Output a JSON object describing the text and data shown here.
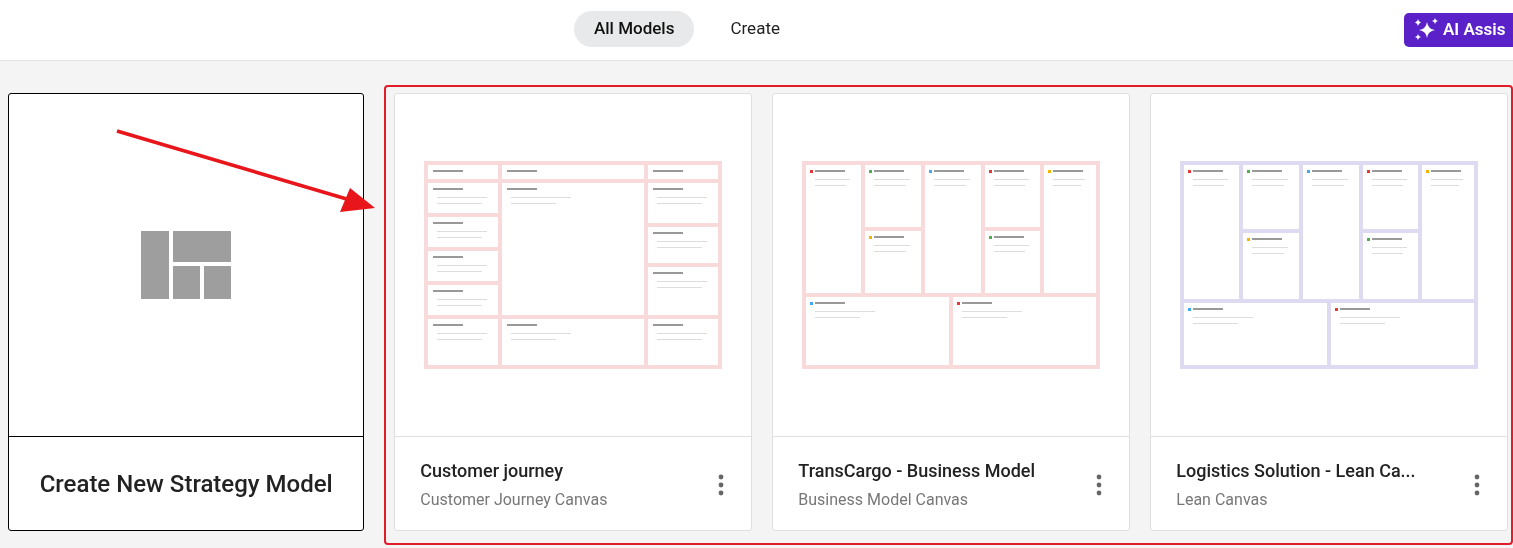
{
  "tabs": [
    {
      "label": "All Models",
      "selected": true
    },
    {
      "label": "Create",
      "selected": false
    }
  ],
  "ai_button": {
    "label": "AI Assis"
  },
  "create_card": {
    "label": "Create New Strategy Model"
  },
  "models": [
    {
      "title": "Customer journey",
      "subtitle": "Customer Journey Canvas"
    },
    {
      "title": "TransCargo - Business Model",
      "subtitle": "Business Model Canvas"
    },
    {
      "title": "Logistics Solution - Lean Ca...",
      "subtitle": "Lean Canvas"
    }
  ]
}
